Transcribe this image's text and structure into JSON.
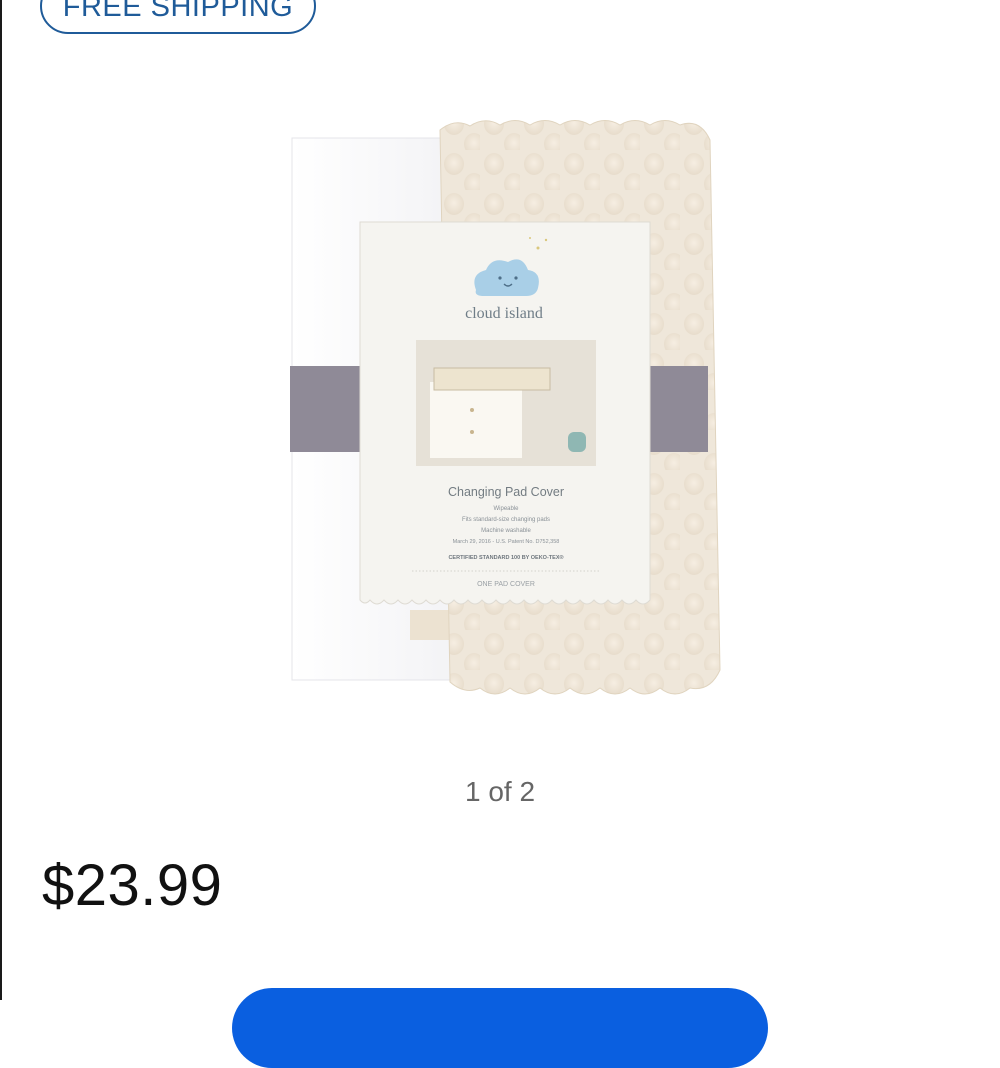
{
  "badge": {
    "label": "FREE SHIPPING"
  },
  "product": {
    "brand": "cloud island",
    "name": "Changing Pad Cover",
    "package_lines": [
      "Wipeable",
      "Fits standard-size changing pads",
      "Machine washable",
      "March 29, 2016 - U.S. Patent No. D752,358"
    ],
    "certification": "CERTIFIED STANDARD 100 BY OEKO-TEX®",
    "quantity_label": "ONE PAD COVER"
  },
  "gallery": {
    "counter": "1 of 2"
  },
  "pricing": {
    "price": "$23.99"
  },
  "colors": {
    "badge_accent": "#1f5b99",
    "cta_blue": "#0a5fe0",
    "price_text": "#111111",
    "counter_text": "#666666"
  }
}
